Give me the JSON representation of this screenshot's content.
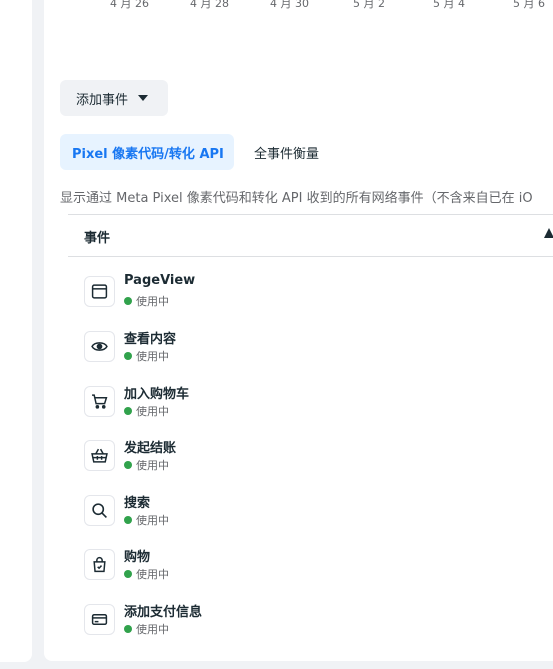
{
  "chart_axis": {
    "ticks": [
      "4 月 26",
      "4 月 28",
      "4 月 30",
      "5 月 2",
      "5 月 4",
      "5 月 6"
    ]
  },
  "toolbar": {
    "add_event_label": "添加事件"
  },
  "tabs": [
    {
      "label": "Pixel 像素代码/转化 API",
      "active": true
    },
    {
      "label": "全事件衡量",
      "active": false
    }
  ],
  "description": "显示通过 Meta Pixel 像素代码和转化 API 收到的所有网络事件（不含来自已在 iO",
  "table": {
    "column_event": "事件",
    "events": [
      {
        "name": "PageView",
        "status": "使用中",
        "icon": "browser-window-icon"
      },
      {
        "name": "查看内容",
        "status": "使用中",
        "icon": "eye-icon"
      },
      {
        "name": "加入购物车",
        "status": "使用中",
        "icon": "cart-icon"
      },
      {
        "name": "发起结账",
        "status": "使用中",
        "icon": "basket-icon"
      },
      {
        "name": "搜索",
        "status": "使用中",
        "icon": "search-icon"
      },
      {
        "name": "购物",
        "status": "使用中",
        "icon": "shopping-bag-icon"
      },
      {
        "name": "添加支付信息",
        "status": "使用中",
        "icon": "credit-card-icon"
      }
    ]
  },
  "colors": {
    "accent": "#1877f2",
    "active_tab_bg": "#e7f3ff",
    "status_green": "#31a24c"
  }
}
